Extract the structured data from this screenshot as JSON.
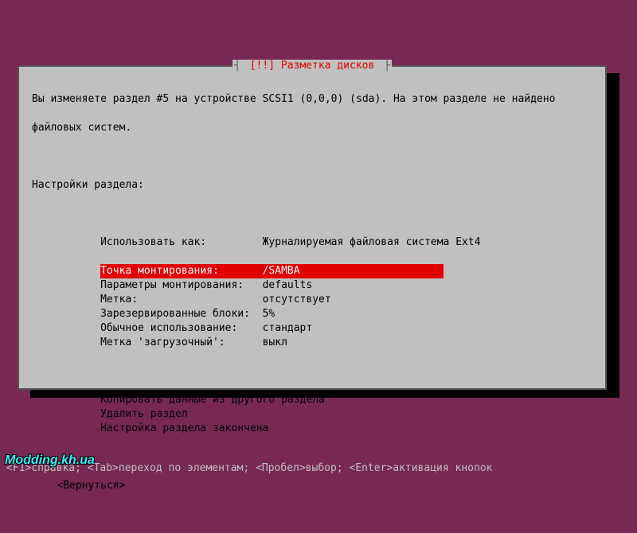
{
  "title": {
    "left": "┤",
    "inner": " [!!] Разметка дисков ",
    "right": "├"
  },
  "msg1": "Вы изменяете раздел #5 на устройстве SCSI1 (0,0,0) (sda). На этом разделе не найдено",
  "msg2": "файловых систем.",
  "heading": "Настройки раздела:",
  "settings": [
    {
      "label": "Использовать как:",
      "value": "Журналируемая файловая система Ext4",
      "selected": false
    },
    {
      "label": "Точка монтирования:",
      "value": "/SAMBA",
      "selected": true
    },
    {
      "label": "Параметры монтирования:",
      "value": "defaults",
      "selected": false
    },
    {
      "label": "Метка:",
      "value": "отсутствует",
      "selected": false
    },
    {
      "label": "Зарезервированные блоки:",
      "value": "5%",
      "selected": false
    },
    {
      "label": "Обычное использование:",
      "value": "стандарт",
      "selected": false
    },
    {
      "label": "Метка 'загрузочный':",
      "value": "выкл",
      "selected": false
    }
  ],
  "actions": [
    {
      "label": "Копировать данные из другого раздела"
    },
    {
      "label": "Удалить раздел"
    },
    {
      "label": "Настройка раздела закончена"
    }
  ],
  "back": "<Вернуться>",
  "footer": "<F1>справка; <Tab>переход по элементам; <Пробел>выбор; <Enter>активация кнопок",
  "watermark": "Modding.kh.ua",
  "indent": "           ",
  "labelCol": 26,
  "selWidth": 55
}
